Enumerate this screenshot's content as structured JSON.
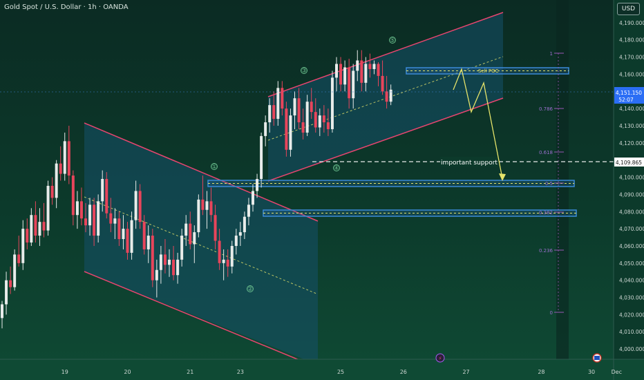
{
  "header": {
    "title": "Gold Spot / U.S. Dollar · 1h · OANDA",
    "currency": "USD"
  },
  "chart_data": {
    "type": "candlestick",
    "ylim": [
      3994,
      4200
    ],
    "y_ticks": [
      "4,190.000",
      "4,180.000",
      "4,170.000",
      "4,160.000",
      "4,150.000",
      "4,140.000",
      "4,130.000",
      "4,120.000",
      "4,110.000",
      "4,100.000",
      "4,090.000",
      "4,080.000",
      "4,070.000",
      "4,060.000",
      "4,050.000",
      "4,040.000",
      "4,030.000",
      "4,020.000",
      "4,010.000",
      "4,000.000"
    ],
    "x_ticks": [
      {
        "label": "19",
        "x_index": 15
      },
      {
        "label": "20",
        "x_index": 30
      },
      {
        "label": "21",
        "x_index": 45
      },
      {
        "label": "23",
        "x_index": 57
      },
      {
        "label": "25",
        "x_index": 81
      },
      {
        "label": "26",
        "x_index": 96
      },
      {
        "label": "27",
        "x_index": 111
      },
      {
        "label": "28",
        "x_index": 129
      },
      {
        "label": "30",
        "x_index": 141
      },
      {
        "label": "Dec",
        "x_index": 147
      }
    ],
    "last_price": "4,151.150",
    "countdown": "52:07",
    "support_price": "4,109.865",
    "candles": [
      [
        4018,
        4028,
        4012,
        4026
      ],
      [
        4026,
        4045,
        4020,
        4040
      ],
      [
        4040,
        4048,
        4032,
        4036
      ],
      [
        4036,
        4058,
        4034,
        4055
      ],
      [
        4055,
        4066,
        4048,
        4050
      ],
      [
        4050,
        4075,
        4046,
        4070
      ],
      [
        4070,
        4076,
        4058,
        4062
      ],
      [
        4062,
        4082,
        4060,
        4078
      ],
      [
        4078,
        4086,
        4062,
        4066
      ],
      [
        4066,
        4082,
        4060,
        4074
      ],
      [
        4074,
        4085,
        4065,
        4069
      ],
      [
        4069,
        4098,
        4066,
        4095
      ],
      [
        4095,
        4100,
        4084,
        4088
      ],
      [
        4088,
        4110,
        4082,
        4108
      ],
      [
        4108,
        4118,
        4098,
        4102
      ],
      [
        4102,
        4126,
        4098,
        4121
      ],
      [
        4121,
        4130,
        4096,
        4101
      ],
      [
        4101,
        4104,
        4072,
        4078
      ],
      [
        4078,
        4092,
        4070,
        4086
      ],
      [
        4086,
        4094,
        4072,
        4076
      ],
      [
        4076,
        4085,
        4068,
        4072
      ],
      [
        4072,
        4088,
        4066,
        4084
      ],
      [
        4084,
        4088,
        4060,
        4066
      ],
      [
        4066,
        4090,
        4062,
        4086
      ],
      [
        4086,
        4104,
        4080,
        4099
      ],
      [
        4099,
        4103,
        4076,
        4079
      ],
      [
        4079,
        4088,
        4068,
        4073
      ],
      [
        4073,
        4082,
        4064,
        4076
      ],
      [
        4076,
        4080,
        4060,
        4064
      ],
      [
        4064,
        4078,
        4058,
        4070
      ],
      [
        4070,
        4074,
        4052,
        4056
      ],
      [
        4056,
        4080,
        4052,
        4075
      ],
      [
        4075,
        4098,
        4070,
        4092
      ],
      [
        4092,
        4096,
        4070,
        4074
      ],
      [
        4074,
        4078,
        4055,
        4058
      ],
      [
        4058,
        4072,
        4050,
        4066
      ],
      [
        4066,
        4070,
        4036,
        4040
      ],
      [
        4040,
        4052,
        4030,
        4046
      ],
      [
        4046,
        4060,
        4038,
        4055
      ],
      [
        4055,
        4064,
        4044,
        4049
      ],
      [
        4049,
        4058,
        4042,
        4052
      ],
      [
        4052,
        4060,
        4040,
        4043
      ],
      [
        4043,
        4056,
        4038,
        4052
      ],
      [
        4052,
        4070,
        4048,
        4066
      ],
      [
        4066,
        4078,
        4060,
        4073
      ],
      [
        4073,
        4080,
        4058,
        4061
      ],
      [
        4061,
        4072,
        4050,
        4068
      ],
      [
        4068,
        4090,
        4065,
        4087
      ],
      [
        4087,
        4101,
        4078,
        4081
      ],
      [
        4081,
        4092,
        4070,
        4086
      ],
      [
        4086,
        4094,
        4074,
        4078
      ],
      [
        4078,
        4084,
        4058,
        4063
      ],
      [
        4063,
        4070,
        4046,
        4050
      ],
      [
        4050,
        4058,
        4040,
        4052
      ],
      [
        4052,
        4058,
        4042,
        4048
      ],
      [
        4048,
        4063,
        4044,
        4060
      ],
      [
        4060,
        4070,
        4055,
        4066
      ],
      [
        4066,
        4074,
        4060,
        4068
      ],
      [
        4068,
        4080,
        4064,
        4077
      ],
      [
        4077,
        4088,
        4072,
        4084
      ],
      [
        4084,
        4096,
        4080,
        4092
      ],
      [
        4092,
        4102,
        4088,
        4099
      ],
      [
        4099,
        4126,
        4094,
        4124
      ],
      [
        4124,
        4136,
        4118,
        4132
      ],
      [
        4132,
        4146,
        4126,
        4142
      ],
      [
        4142,
        4150,
        4130,
        4134
      ],
      [
        4134,
        4156,
        4130,
        4152
      ],
      [
        4152,
        4156,
        4136,
        4140
      ],
      [
        4140,
        4144,
        4112,
        4116
      ],
      [
        4116,
        4140,
        4112,
        4136
      ],
      [
        4136,
        4150,
        4128,
        4146
      ],
      [
        4146,
        4152,
        4128,
        4132
      ],
      [
        4132,
        4140,
        4122,
        4126
      ],
      [
        4126,
        4148,
        4124,
        4144
      ],
      [
        4144,
        4152,
        4134,
        4138
      ],
      [
        4138,
        4146,
        4126,
        4129
      ],
      [
        4129,
        4140,
        4124,
        4136
      ],
      [
        4136,
        4142,
        4126,
        4132
      ],
      [
        4132,
        4140,
        4124,
        4128
      ],
      [
        4128,
        4162,
        4126,
        4158
      ],
      [
        4158,
        4170,
        4150,
        4166
      ],
      [
        4166,
        4170,
        4150,
        4154
      ],
      [
        4154,
        4168,
        4150,
        4164
      ],
      [
        4164,
        4169,
        4140,
        4146
      ],
      [
        4146,
        4166,
        4140,
        4162
      ],
      [
        4162,
        4174,
        4156,
        4168
      ],
      [
        4168,
        4174,
        4150,
        4155
      ],
      [
        4155,
        4170,
        4150,
        4166
      ],
      [
        4166,
        4172,
        4158,
        4163
      ],
      [
        4163,
        4168,
        4160,
        4166
      ],
      [
        4166,
        4167,
        4153,
        4159
      ],
      [
        4159,
        4168,
        4148,
        4150
      ],
      [
        4150,
        4159,
        4140,
        4144
      ],
      [
        4144,
        4154,
        4142,
        4151
      ]
    ]
  },
  "annotations": {
    "wave_labels": [
      "①",
      "②",
      "③",
      "④",
      "⑤"
    ],
    "sell_poc_label": "Sell POC",
    "support_label": "important support",
    "fib_labels": [
      "1",
      "0.786",
      "0.618",
      "0.5",
      "0.382",
      "0.236",
      "0"
    ]
  },
  "colors": {
    "bull": "#e8ecea",
    "bear": "#e8455b",
    "channel": "#e8456f",
    "channel_fill": "#16516a",
    "zone": "#3b8ad8",
    "zone_mid": "#e6e46a",
    "arrow": "#e6e46a",
    "fib": "#9b59b6",
    "support_line": "#e8ecea",
    "price_badge": "#2b6ef5"
  }
}
